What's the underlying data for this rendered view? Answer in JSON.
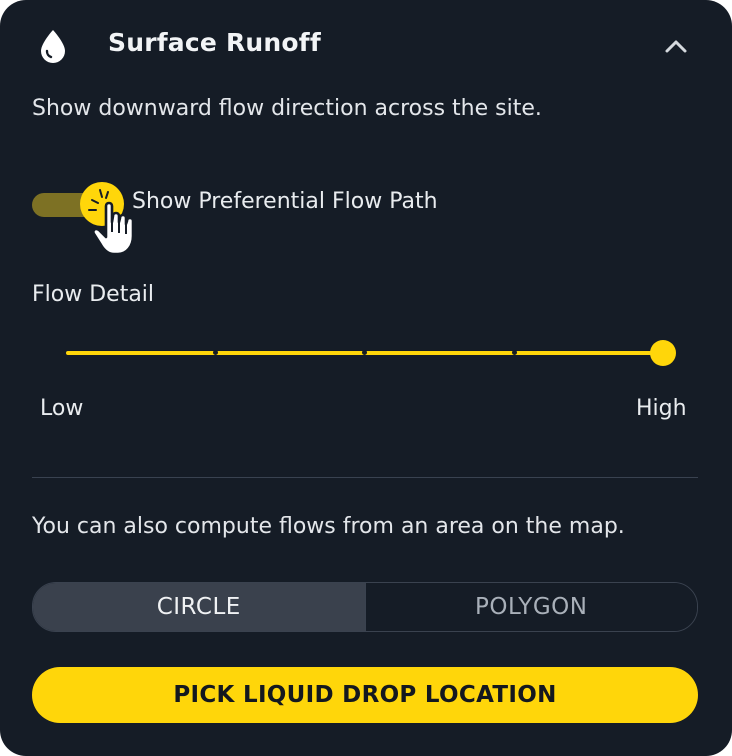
{
  "panel": {
    "title": "Surface Runoff",
    "header_icon": "water-drop-icon",
    "collapse_icon": "chevron-up-icon",
    "description": "Show downward flow direction across the site."
  },
  "toggle": {
    "label": "Show Preferential Flow Path",
    "on": true
  },
  "cursor_icon": "hand-pointer-cursor-icon",
  "slider": {
    "label": "Flow Detail",
    "min_label": "Low",
    "max_label": "High",
    "steps": 5,
    "value_fraction": 1.0
  },
  "area": {
    "text": "You can also compute flows from an area on the map.",
    "options": [
      "CIRCLE",
      "POLYGON"
    ],
    "selected": "CIRCLE"
  },
  "cta": {
    "label": "PICK LIQUID DROP LOCATION"
  },
  "colors": {
    "background": "#151c26",
    "accent": "#ffd60a",
    "toggle_track": "#7d7124",
    "segment_active": "#3a414d"
  }
}
